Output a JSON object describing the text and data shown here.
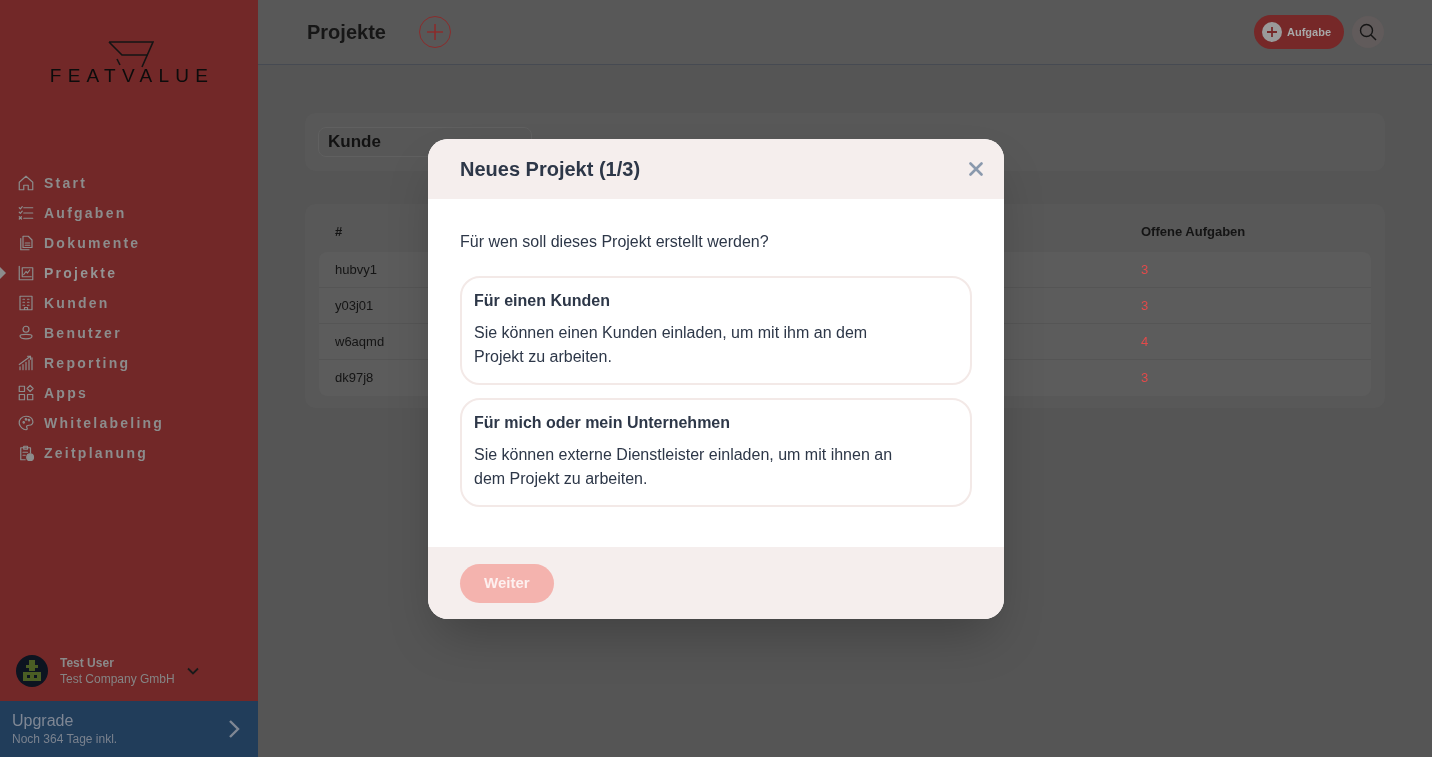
{
  "sidebar": {
    "logo": {
      "text": "FEATVALUE"
    },
    "nav_items": [
      {
        "label": "Start",
        "selected": false
      },
      {
        "label": "Aufgaben",
        "selected": false
      },
      {
        "label": "Dokumente",
        "selected": false
      },
      {
        "label": "Projekte",
        "selected": true
      },
      {
        "label": "Kunden",
        "selected": false
      },
      {
        "label": "Benutzer",
        "selected": false
      },
      {
        "label": "Reporting",
        "selected": false
      },
      {
        "label": "Apps",
        "selected": false
      },
      {
        "label": "Whitelabeling",
        "selected": false
      },
      {
        "label": "Zeitplanung",
        "selected": false
      }
    ],
    "user": {
      "name": "Test User",
      "company": "Test Company GmbH"
    },
    "upgrade": {
      "title": "Upgrade",
      "subtitle": "Noch 364 Tage inkl."
    }
  },
  "header": {
    "title": "Projekte",
    "task_button": {
      "label": "Aufgabe"
    }
  },
  "filter": {
    "field": {
      "value": "Kunde"
    }
  },
  "table": {
    "columns": [
      "#",
      "Offene Aufgaben"
    ],
    "rows": [
      {
        "cells": [
          "hubvy1",
          "3"
        ]
      },
      {
        "cells": [
          "y03j01",
          "3"
        ]
      },
      {
        "cells": [
          "w6aqmd",
          "4"
        ]
      },
      {
        "cells": [
          "dk97j8",
          "3"
        ]
      }
    ]
  },
  "dialog": {
    "title": "Neues Projekt (1/3)",
    "question": "Für wen soll dieses Projekt erstellt werden?",
    "options": [
      {
        "title": "Für einen Kunden",
        "description": "Sie können einen Kunden einladen, um mit ihm an dem Projekt zu arbeiten.",
        "selected": false
      },
      {
        "title": "Für mich oder mein Unternehmen",
        "description": "Sie können externe Dienstleister einladen, um mit ihnen an dem Projekt zu arbeiten.",
        "selected": false
      }
    ],
    "next_button": {
      "label": "Weiter",
      "disabled": true
    }
  }
}
